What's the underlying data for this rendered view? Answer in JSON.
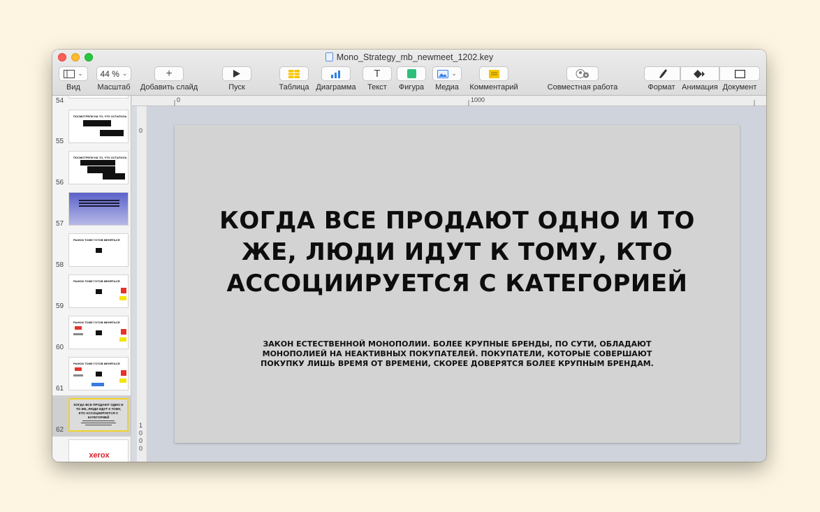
{
  "window": {
    "title": "Mono_Strategy_mb_newmeet_1202.key"
  },
  "toolbar": {
    "view_label": "Вид",
    "zoom_value": "44 %",
    "zoom_label": "Масштаб",
    "add_slide_label": "Добавить слайд",
    "play_label": "Пуск",
    "table_label": "Таблица",
    "chart_label": "Диаграмма",
    "text_label": "Текст",
    "shape_label": "Фигура",
    "media_label": "Медиа",
    "comment_label": "Комментарий",
    "collaborate_label": "Совместная работа",
    "format_label": "Формат",
    "animate_label": "Анимация",
    "document_label": "Документ"
  },
  "sidebar": {
    "slides": [
      {
        "number": "54",
        "title": ""
      },
      {
        "number": "55",
        "title": "ПОСМОТРЕЛИ НА ТО, ЧТО ОСТАЛОСЬ"
      },
      {
        "number": "56",
        "title": "ПОСМОТРЕЛИ НА ТО, ЧТО ОСТАЛОСЬ"
      },
      {
        "number": "57",
        "title": ""
      },
      {
        "number": "58",
        "title": "РЫНОК ТОЖЕ ГОТОВ МЕНЯТЬСЯ"
      },
      {
        "number": "59",
        "title": "РЫНОК ТОЖЕ ГОТОВ МЕНЯТЬСЯ"
      },
      {
        "number": "60",
        "title": "РЫНОК ТОЖЕ ГОТОВ МЕНЯТЬСЯ"
      },
      {
        "number": "61",
        "title": "РЫНОК ТОЖЕ ГОТОВ МЕНЯТЬСЯ"
      },
      {
        "number": "62",
        "title": "КОГДА ВСЕ ПРОДАЮТ ОДНО И ТО ЖЕ, ЛЮДИ ИДУТ К ТОМУ, КТО АССОЦИИРУЕТСЯ С КАТЕГОРИЕЙ"
      },
      {
        "number": "",
        "title": "xerox"
      }
    ]
  },
  "rulers": {
    "top_start": "0",
    "top_mark": "1000",
    "left_start": "0",
    "left_mark": "1000"
  },
  "slide": {
    "title": "КОГДА ВСЕ ПРОДАЮТ ОДНО И ТО ЖЕ, ЛЮДИ ИДУТ К ТОМУ, КТО АССОЦИИРУЕТСЯ С КАТЕГОРИЕЙ",
    "body": "ЗАКОН ЕСТЕСТВЕННОЙ МОНОПОЛИИ. БОЛЕЕ КРУПНЫЕ БРЕНДЫ, ПО СУТИ, ОБЛАДАЮТ МОНОПОЛИЕЙ НА НЕАКТИВНЫХ ПОКУПАТЕЛЕЙ. ПОКУПАТЕЛИ, КОТОРЫЕ СОВЕРШАЮТ ПОКУПКУ ЛИШЬ ВРЕМЯ ОТ ВРЕМЕНИ, СКОРЕЕ ДОВЕРЯТСЯ БОЛЕЕ КРУПНЫМ БРЕНДАМ."
  },
  "colors": {
    "accent_table": "#f5c400",
    "accent_shape": "#2dbf7a",
    "accent_chart": "#2f7ee8",
    "selection": "#f2d22a"
  }
}
